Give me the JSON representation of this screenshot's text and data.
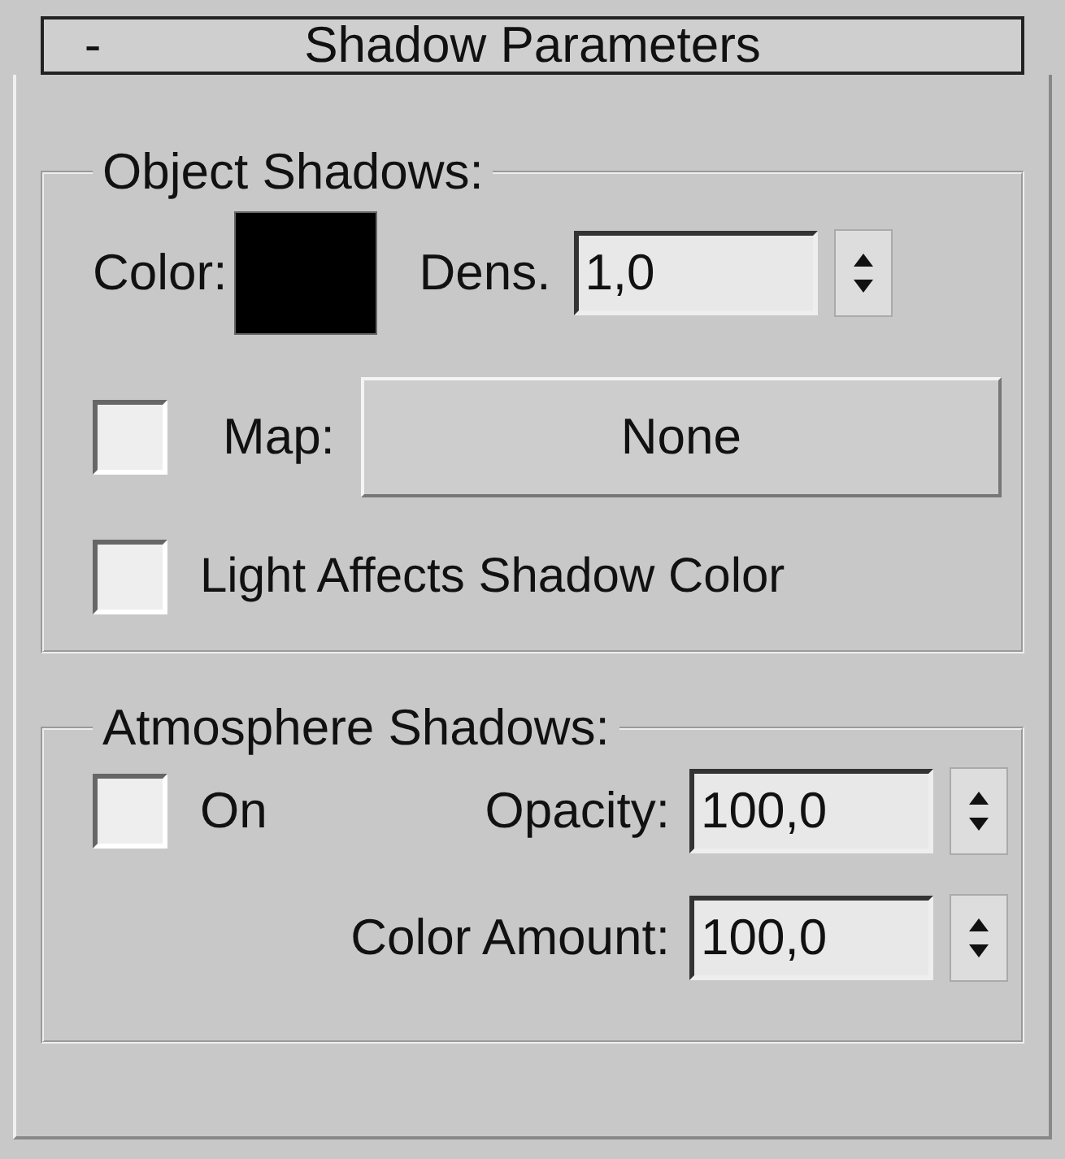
{
  "rollout": {
    "collapse_symbol": "-",
    "title": "Shadow Parameters"
  },
  "object_shadows": {
    "title": "Object Shadows:",
    "color_label": "Color:",
    "color": "#000000",
    "density_label": "Dens.",
    "density": "1,0",
    "map_checked": false,
    "map_label": "Map:",
    "map_button": "None",
    "light_affects_checked": false,
    "light_affects_label": "Light Affects Shadow Color"
  },
  "atmosphere_shadows": {
    "title": "Atmosphere Shadows:",
    "on_checked": false,
    "on_label": "On",
    "opacity_label": "Opacity:",
    "opacity": "100,0",
    "color_amount_label": "Color Amount:",
    "color_amount": "100,0"
  }
}
